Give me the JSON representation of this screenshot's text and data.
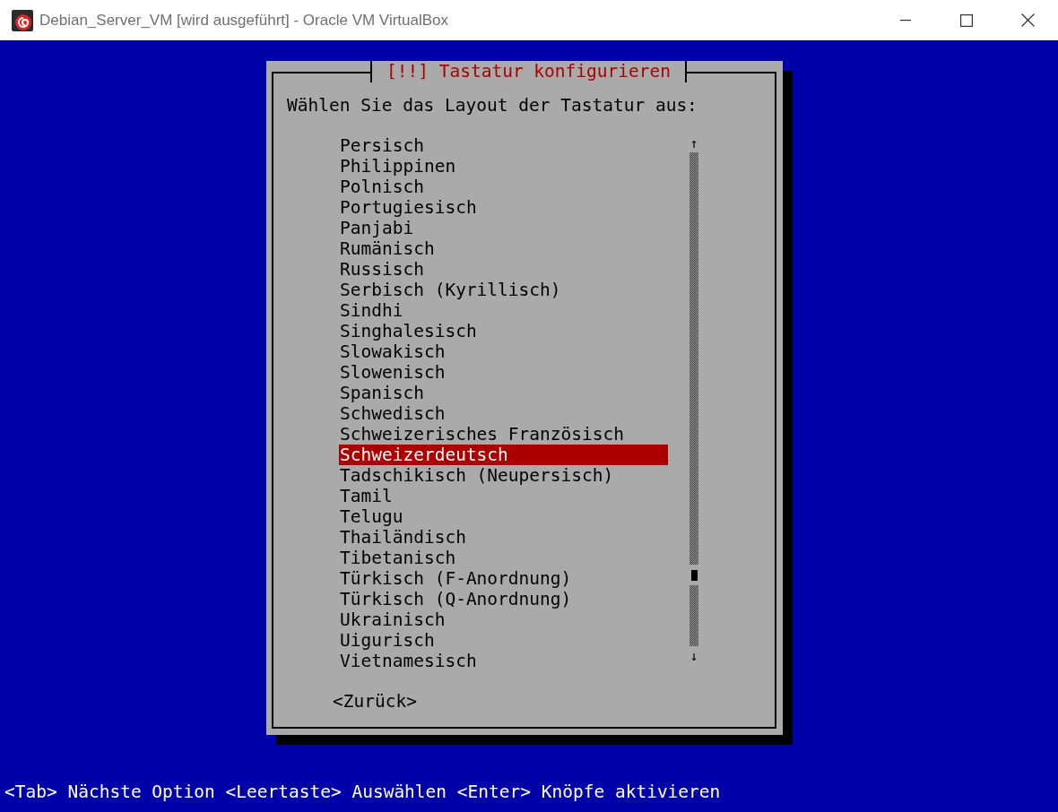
{
  "window": {
    "title": "Debian_Server_VM [wird ausgeführt] - Oracle VM VirtualBox"
  },
  "dialog": {
    "title": "[!!] Tastatur konfigurieren",
    "prompt": "Wählen Sie das Layout der Tastatur aus:",
    "items": [
      {
        "label": "Persisch",
        "selected": false
      },
      {
        "label": "Philippinen",
        "selected": false
      },
      {
        "label": "Polnisch",
        "selected": false
      },
      {
        "label": "Portugiesisch",
        "selected": false
      },
      {
        "label": "Panjabi",
        "selected": false
      },
      {
        "label": "Rumänisch",
        "selected": false
      },
      {
        "label": "Russisch",
        "selected": false
      },
      {
        "label": "Serbisch (Kyrillisch)",
        "selected": false
      },
      {
        "label": "Sindhi",
        "selected": false
      },
      {
        "label": "Singhalesisch",
        "selected": false
      },
      {
        "label": "Slowakisch",
        "selected": false
      },
      {
        "label": "Slowenisch",
        "selected": false
      },
      {
        "label": "Spanisch",
        "selected": false
      },
      {
        "label": "Schwedisch",
        "selected": false
      },
      {
        "label": "Schweizerisches Französisch",
        "selected": false
      },
      {
        "label": "Schweizerdeutsch",
        "selected": true
      },
      {
        "label": "Tadschikisch (Neupersisch)",
        "selected": false
      },
      {
        "label": "Tamil",
        "selected": false
      },
      {
        "label": "Telugu",
        "selected": false
      },
      {
        "label": "Thailändisch",
        "selected": false
      },
      {
        "label": "Tibetanisch",
        "selected": false
      },
      {
        "label": "Türkisch (F-Anordnung)",
        "selected": false
      },
      {
        "label": "Türkisch (Q-Anordnung)",
        "selected": false
      },
      {
        "label": "Ukrainisch",
        "selected": false
      },
      {
        "label": "Uigurisch",
        "selected": false
      },
      {
        "label": "Vietnamesisch",
        "selected": false
      }
    ],
    "scroll_up": "↑",
    "scroll_down": "↓",
    "buttons": [
      "<Zurück>"
    ]
  },
  "status_bar": "<Tab> Nächste Option <Leertaste> Auswählen <Enter> Knöpfe aktivieren"
}
